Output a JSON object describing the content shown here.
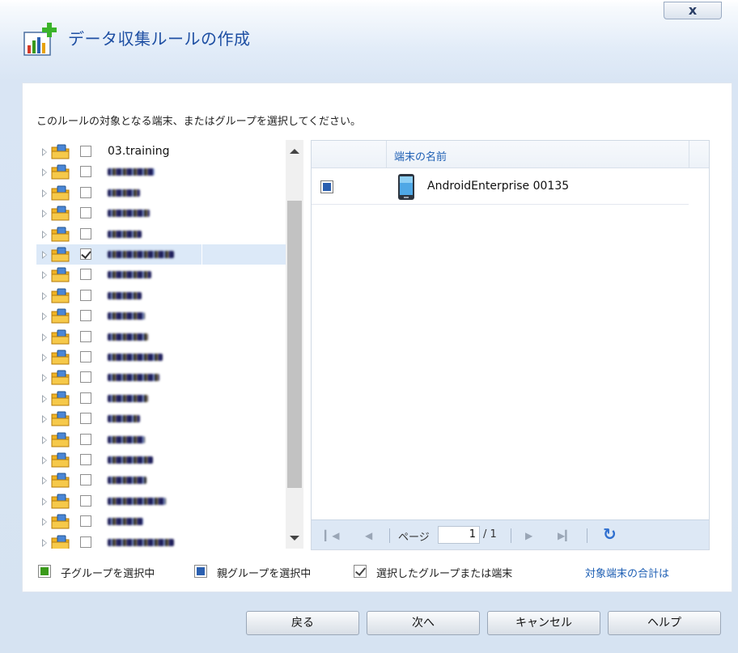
{
  "window": {
    "title": "データ収集ルールの作成",
    "close_label": "x",
    "title_icon": "rule-chart-add-icon"
  },
  "instruction": "このルールの対象となる端末、またはグループを選択してください。",
  "tree": {
    "items": [
      {
        "label": "03.training",
        "checked": false,
        "obscured": false,
        "selected": false
      },
      {
        "label": "",
        "checked": false,
        "obscured": true,
        "selected": false
      },
      {
        "label": "",
        "checked": false,
        "obscured": true,
        "selected": false
      },
      {
        "label": "",
        "checked": false,
        "obscured": true,
        "selected": false
      },
      {
        "label": "",
        "checked": false,
        "obscured": true,
        "selected": false
      },
      {
        "label": "",
        "checked": true,
        "obscured": true,
        "selected": true
      },
      {
        "label": "",
        "checked": false,
        "obscured": true,
        "selected": false
      },
      {
        "label": "",
        "checked": false,
        "obscured": true,
        "selected": false
      },
      {
        "label": "",
        "checked": false,
        "obscured": true,
        "selected": false
      },
      {
        "label": "",
        "checked": false,
        "obscured": true,
        "selected": false
      },
      {
        "label": "",
        "checked": false,
        "obscured": true,
        "selected": false
      },
      {
        "label": "",
        "checked": false,
        "obscured": true,
        "selected": false
      },
      {
        "label": "",
        "checked": false,
        "obscured": true,
        "selected": false
      },
      {
        "label": "",
        "checked": false,
        "obscured": true,
        "selected": false
      },
      {
        "label": "",
        "checked": false,
        "obscured": true,
        "selected": false
      },
      {
        "label": "",
        "checked": false,
        "obscured": true,
        "selected": false
      },
      {
        "label": "",
        "checked": false,
        "obscured": true,
        "selected": false
      },
      {
        "label": "",
        "checked": false,
        "obscured": true,
        "selected": false
      },
      {
        "label": "",
        "checked": false,
        "obscured": true,
        "selected": false
      },
      {
        "label": "",
        "checked": false,
        "obscured": true,
        "selected": false
      }
    ]
  },
  "grid": {
    "column_name": "端末の名前",
    "rows": [
      {
        "name": "AndroidEnterprise 00135",
        "icon": "android-phone-icon"
      }
    ]
  },
  "pager": {
    "label": "ページ",
    "current": "1",
    "total": "/ 1",
    "first_icon": "first-page-icon",
    "prev_icon": "prev-page-icon",
    "next_icon": "next-page-icon",
    "last_icon": "last-page-icon",
    "refresh_icon": "refresh-icon"
  },
  "legend": {
    "child": "子グループを選択中",
    "parent": "親グループを選択中",
    "selected": "選択したグループまたは端末",
    "child_color": "#3a9a1a",
    "parent_color": "#2a5fb0"
  },
  "total_link": "対象端末の合計は",
  "buttons": {
    "back": "戻る",
    "next": "次へ",
    "cancel": "キャンセル",
    "help": "ヘルプ"
  }
}
